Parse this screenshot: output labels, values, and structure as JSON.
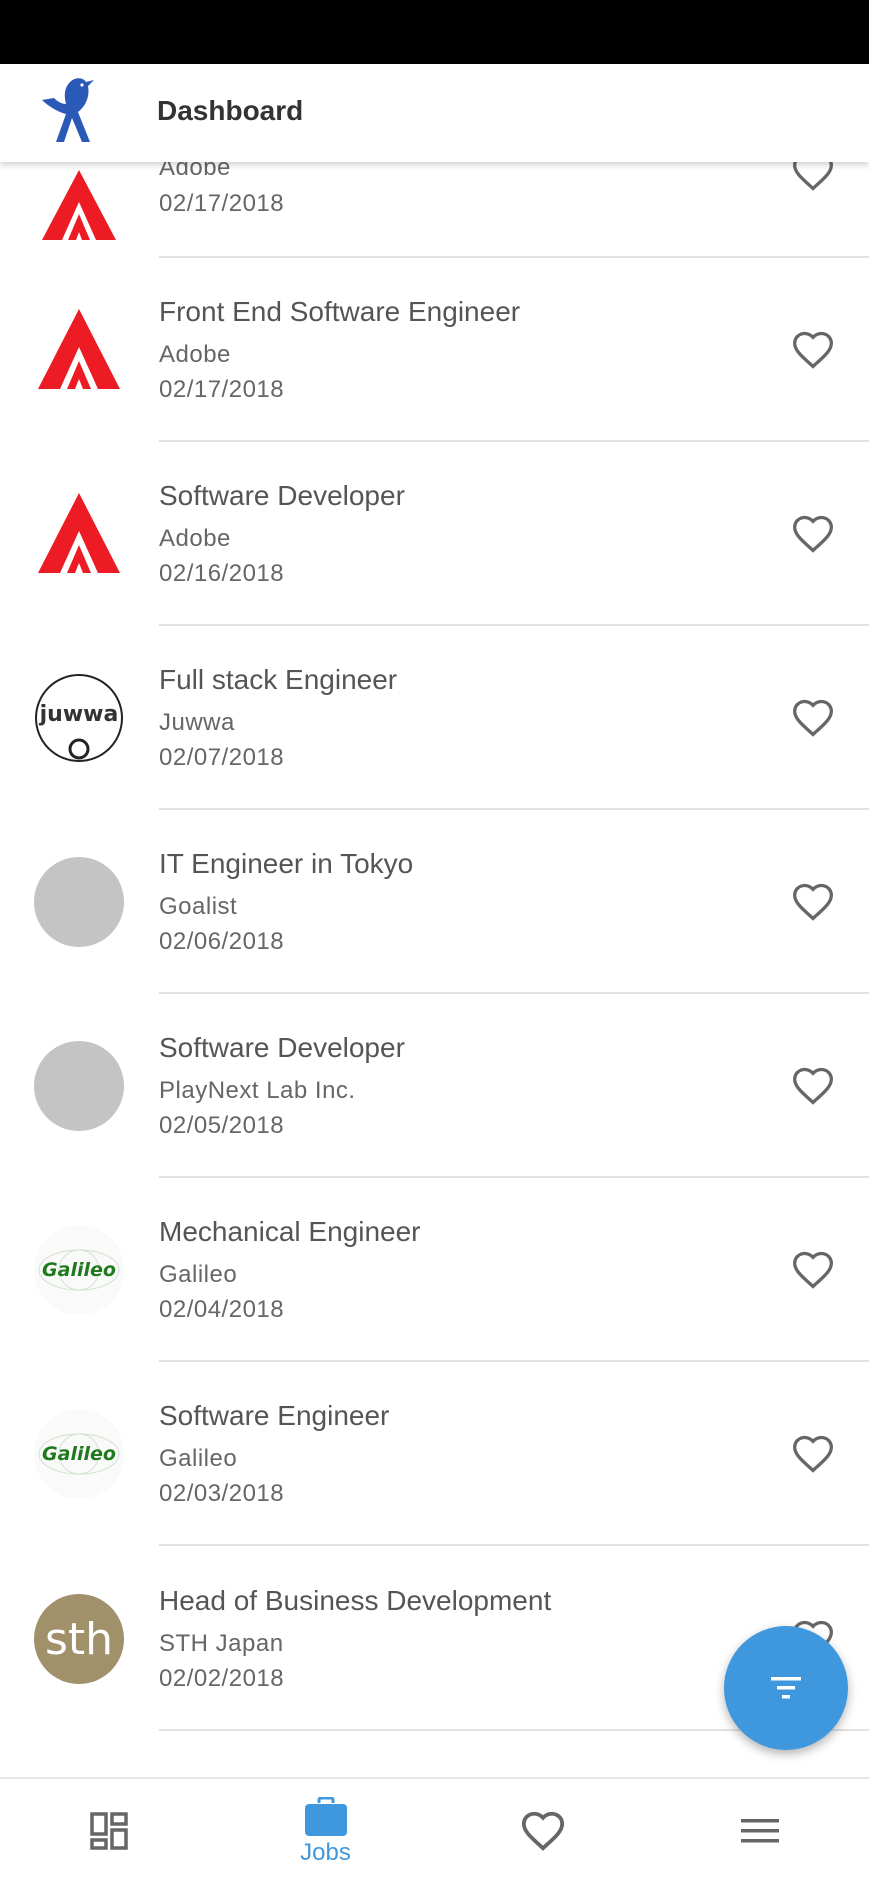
{
  "app_bar": {
    "title": "Dashboard"
  },
  "top_partial_job": {
    "company": "Adobe",
    "date": "02/17/2018"
  },
  "jobs": [
    {
      "title": "Front End Software Engineer",
      "company": "Adobe",
      "date": "02/17/2018",
      "logo": "adobe-logo"
    },
    {
      "title": "Software Developer",
      "company": "Adobe",
      "date": "02/16/2018",
      "logo": "adobe-logo"
    },
    {
      "title": "Full stack Engineer",
      "company": "Juwwa",
      "date": "02/07/2018",
      "logo": "juwwa-logo",
      "logo_text": "juwwa"
    },
    {
      "title": "IT Engineer in Tokyo",
      "company": "Goalist",
      "date": "02/06/2018",
      "logo": "placeholder-logo"
    },
    {
      "title": "Software Developer",
      "company": "PlayNext Lab Inc.",
      "date": "02/05/2018",
      "logo": "placeholder-logo"
    },
    {
      "title": "Mechanical Engineer",
      "company": "Galileo",
      "date": "02/04/2018",
      "logo": "galileo-logo",
      "logo_text": "Galileo"
    },
    {
      "title": "Software Engineer",
      "company": "Galileo",
      "date": "02/03/2018",
      "logo": "galileo-logo",
      "logo_text": "Galileo"
    },
    {
      "title": "Head of Business Development",
      "company": "STH Japan",
      "date": "02/02/2018",
      "logo": "sth-logo",
      "logo_text": "sth"
    }
  ],
  "bottom_nav": {
    "items": [
      {
        "name": "dashboard",
        "icon": "dashboard-icon",
        "label": ""
      },
      {
        "name": "jobs",
        "icon": "briefcase-icon",
        "label": "Jobs",
        "active": true
      },
      {
        "name": "favorites",
        "icon": "heart-icon",
        "label": ""
      },
      {
        "name": "menu",
        "icon": "menu-icon",
        "label": ""
      }
    ]
  },
  "colors": {
    "accent": "#3f98de",
    "adobe_red": "#ed1c24",
    "placeholder_grey": "#c4c4c4",
    "sth_gold": "#a1916a",
    "galileo_green": "#1f7a1f"
  }
}
